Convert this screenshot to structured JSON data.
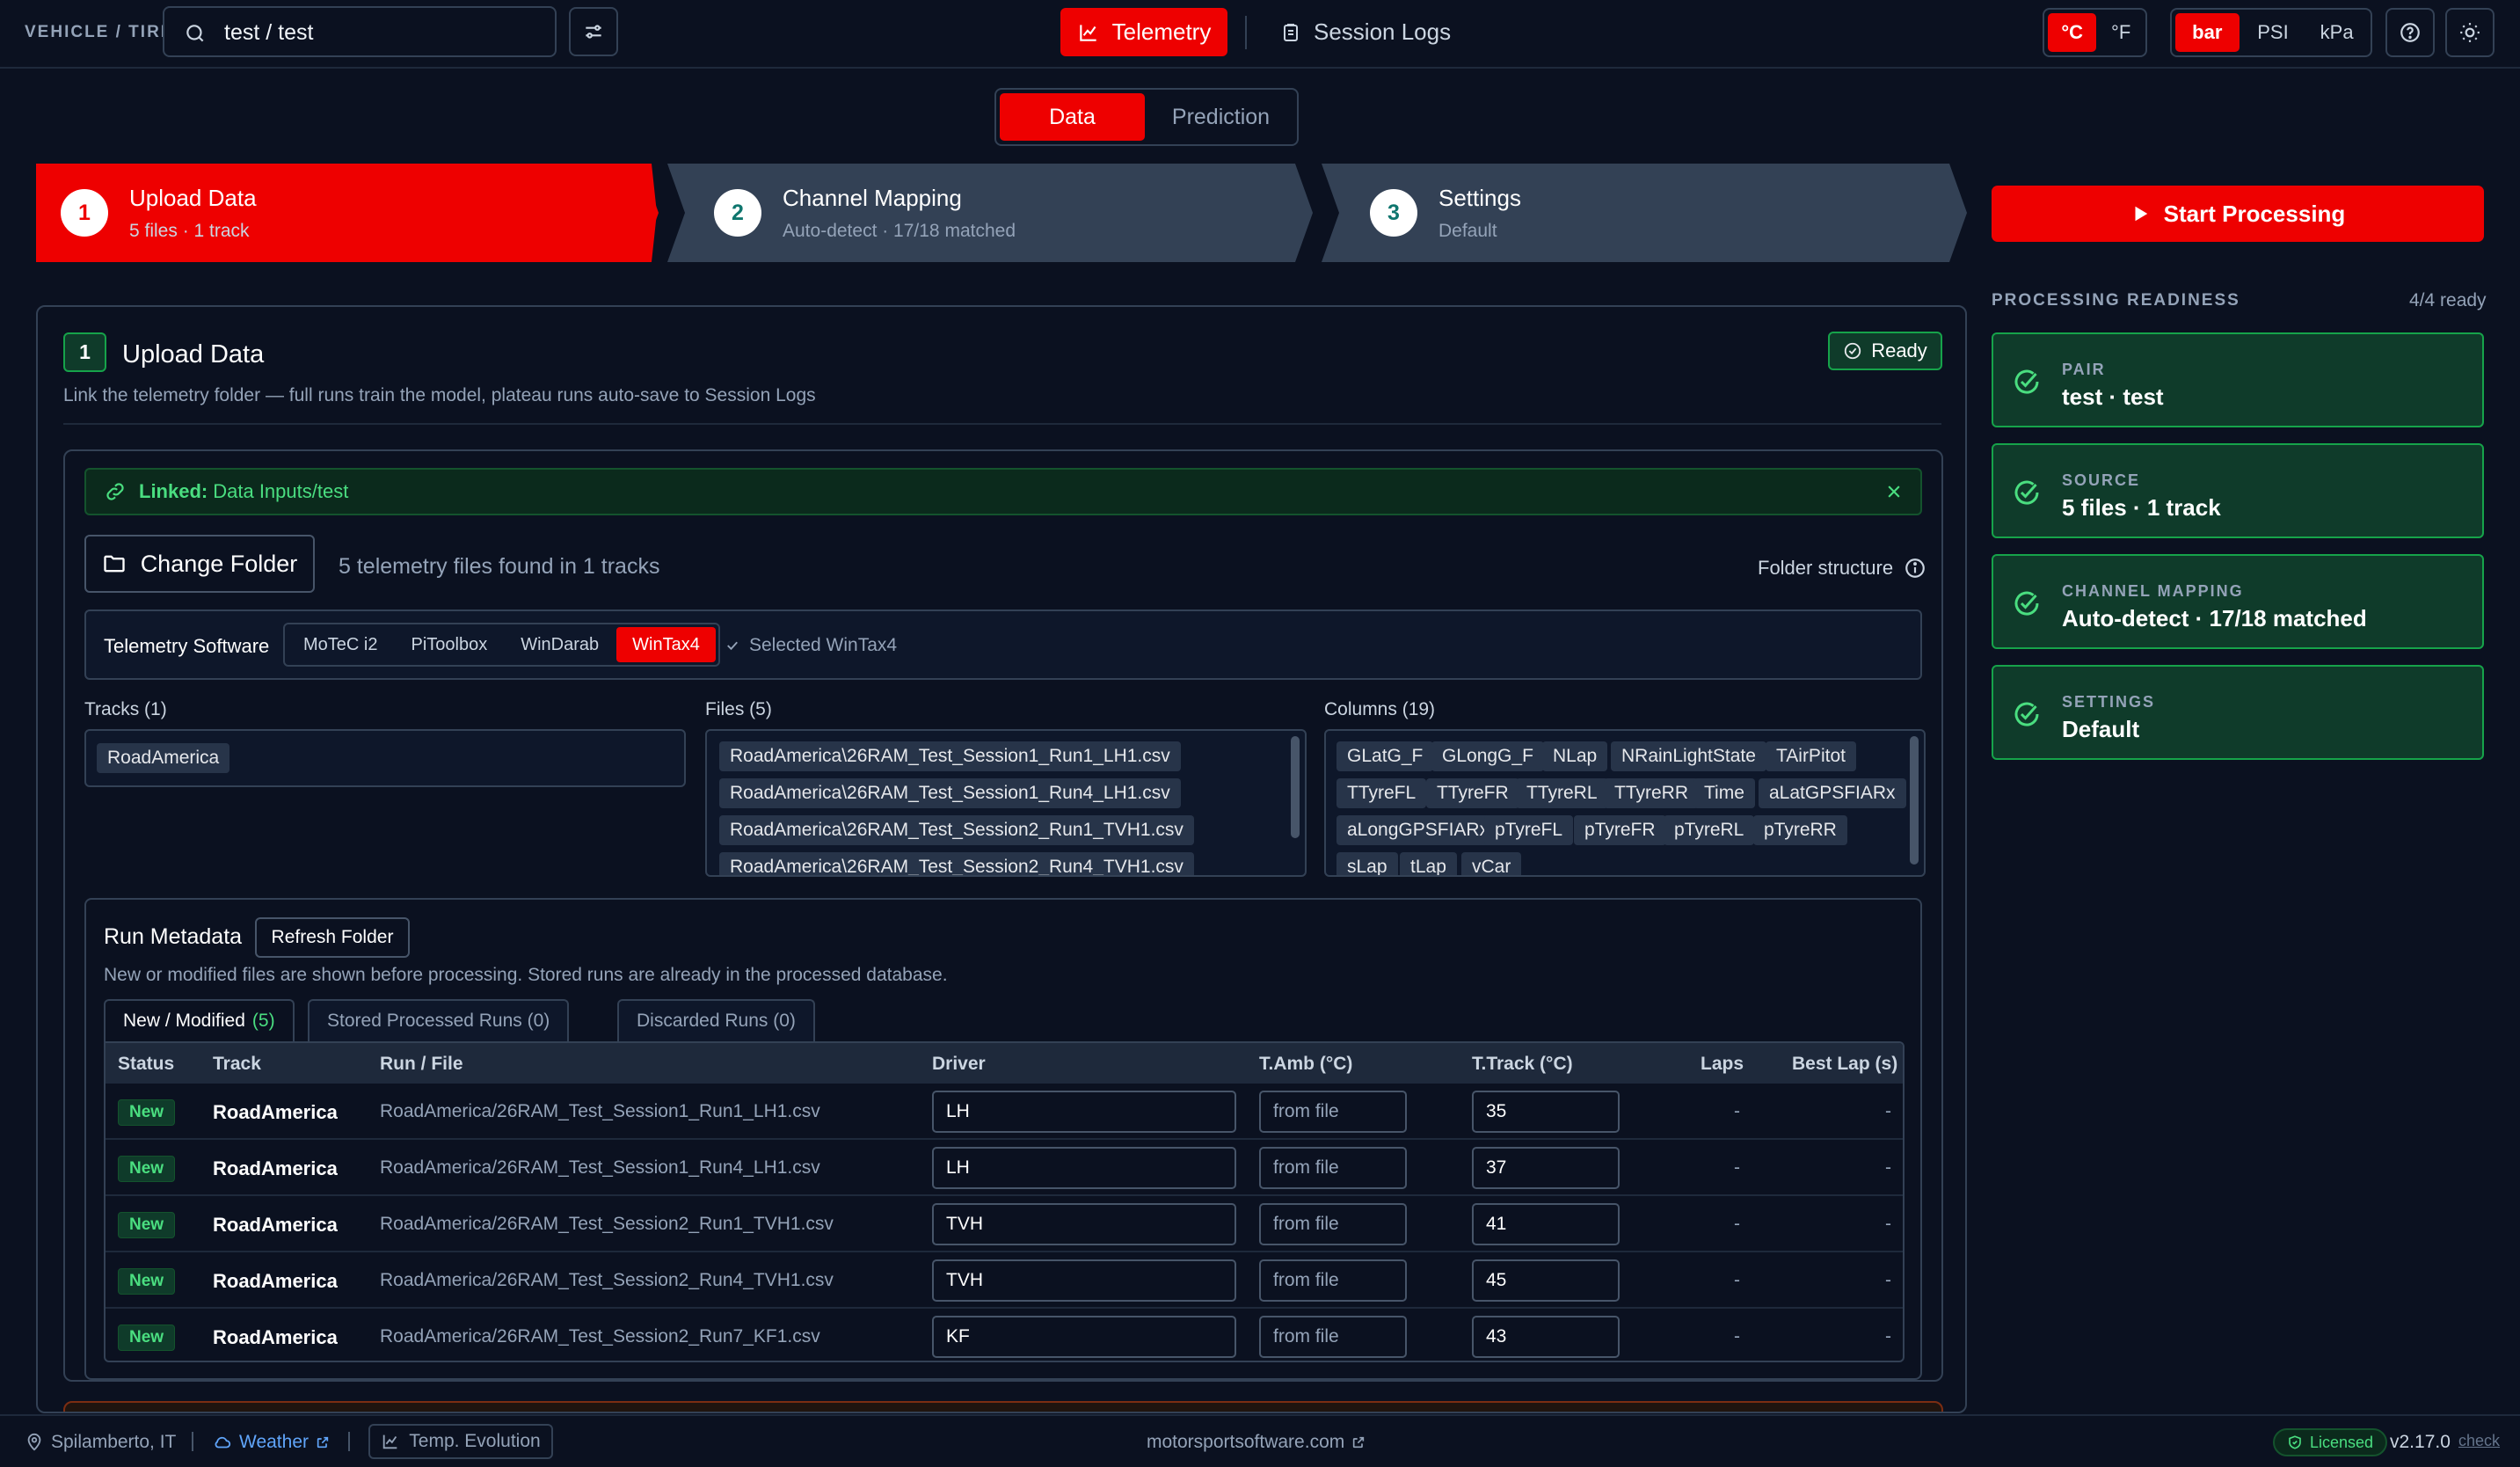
{
  "topbar": {
    "vehicle_tire_label": "VEHICLE / TIRE",
    "search_value": "test / test",
    "telemetry_label": "Telemetry",
    "session_logs_label": "Session Logs",
    "temp_units": [
      "°C",
      "°F"
    ],
    "temp_selected": "°C",
    "pressure_units": [
      "bar",
      "PSI",
      "kPa"
    ],
    "pressure_selected": "bar"
  },
  "mode_toggle": {
    "data": "Data",
    "prediction": "Prediction",
    "selected": "Data"
  },
  "steps": [
    {
      "number": "1",
      "title": "Upload Data",
      "subtitle": "5 files · 1 track",
      "active": true
    },
    {
      "number": "2",
      "title": "Channel Mapping",
      "subtitle": "Auto-detect · 17/18 matched",
      "active": false
    },
    {
      "number": "3",
      "title": "Settings",
      "subtitle": "Default",
      "active": false
    }
  ],
  "start_processing_label": "Start Processing",
  "upload": {
    "step_badge": "1",
    "title": "Upload Data",
    "subtitle": "Link the telemetry folder — full runs train the model, plateau runs auto-save to Session Logs",
    "ready_label": "Ready",
    "linked_label": "Linked:",
    "linked_path": "Data Inputs/test",
    "change_folder_label": "Change Folder",
    "found_text": "5 telemetry files found in 1 tracks",
    "folder_structure_label": "Folder structure",
    "software_label": "Telemetry Software",
    "software_options": [
      "MoTeC i2",
      "PiToolbox",
      "WinDarab",
      "WinTax4"
    ],
    "software_selected": "WinTax4",
    "software_selected_text": "Selected WinTax4",
    "tracks_header": "Tracks (1)",
    "tracks": [
      "RoadAmerica"
    ],
    "files_header": "Files (5)",
    "files": [
      "RoadAmerica\\26RAM_Test_Session1_Run1_LH1.csv",
      "RoadAmerica\\26RAM_Test_Session1_Run4_LH1.csv",
      "RoadAmerica\\26RAM_Test_Session2_Run1_TVH1.csv",
      "RoadAmerica\\26RAM_Test_Session2_Run4_TVH1.csv"
    ],
    "columns_header": "Columns (19)",
    "columns": [
      "GLatG_F",
      "GLongG_F",
      "NLap",
      "NRainLightState",
      "TAirPitot",
      "TTyreFL",
      "TTyreFR",
      "TTyreRL",
      "TTyreRR",
      "Time",
      "aLatGPSFIARx",
      "aLongGPSFIARx",
      "pTyreFL",
      "pTyreFR",
      "pTyreRL",
      "pTyreRR",
      "sLap",
      "tLap",
      "vCar"
    ]
  },
  "run_metadata": {
    "title": "Run Metadata",
    "refresh_label": "Refresh Folder",
    "subtitle": "New or modified files are shown before processing. Stored runs are already in the processed database.",
    "tabs": [
      {
        "label": "New / Modified",
        "count": "(5)"
      },
      {
        "label": "Stored Processed Runs (0)",
        "count": ""
      },
      {
        "label": "Discarded Runs (0)",
        "count": ""
      }
    ],
    "columns": [
      "Status",
      "Track",
      "Run / File",
      "Driver",
      "T.Amb (°C)",
      "T.Track (°C)",
      "Laps",
      "Best Lap (s)"
    ],
    "tamb_placeholder": "from file",
    "rows": [
      {
        "status": "New",
        "track": "RoadAmerica",
        "file": "RoadAmerica/26RAM_Test_Session1_Run1_LH1.csv",
        "driver": "LH",
        "ttrack": "35",
        "laps": "-",
        "best": "-"
      },
      {
        "status": "New",
        "track": "RoadAmerica",
        "file": "RoadAmerica/26RAM_Test_Session1_Run4_LH1.csv",
        "driver": "LH",
        "ttrack": "37",
        "laps": "-",
        "best": "-"
      },
      {
        "status": "New",
        "track": "RoadAmerica",
        "file": "RoadAmerica/26RAM_Test_Session2_Run1_TVH1.csv",
        "driver": "TVH",
        "ttrack": "41",
        "laps": "-",
        "best": "-"
      },
      {
        "status": "New",
        "track": "RoadAmerica",
        "file": "RoadAmerica/26RAM_Test_Session2_Run4_TVH1.csv",
        "driver": "TVH",
        "ttrack": "45",
        "laps": "-",
        "best": "-"
      },
      {
        "status": "New",
        "track": "RoadAmerica",
        "file": "RoadAmerica/26RAM_Test_Session2_Run7_KF1.csv",
        "driver": "KF",
        "ttrack": "43",
        "laps": "-",
        "best": "-"
      }
    ]
  },
  "readiness": {
    "label": "PROCESSING READINESS",
    "count": "4/4 ready",
    "cards": [
      {
        "label": "PAIR",
        "value": "test · test"
      },
      {
        "label": "SOURCE",
        "value": "5 files · 1 track"
      },
      {
        "label": "CHANNEL MAPPING",
        "value": "Auto-detect · 17/18 matched"
      },
      {
        "label": "SETTINGS",
        "value": "Default"
      }
    ]
  },
  "footer": {
    "location": "Spilamberto, IT",
    "weather": "Weather",
    "temp_evolution": "Temp. Evolution",
    "site": "motorsportsoftware.com",
    "licensed": "Licensed",
    "version": "v2.17.0",
    "check": "check"
  },
  "colors": {
    "accent": "#ee0000",
    "success": "#16a34a",
    "background": "#0b1120"
  }
}
